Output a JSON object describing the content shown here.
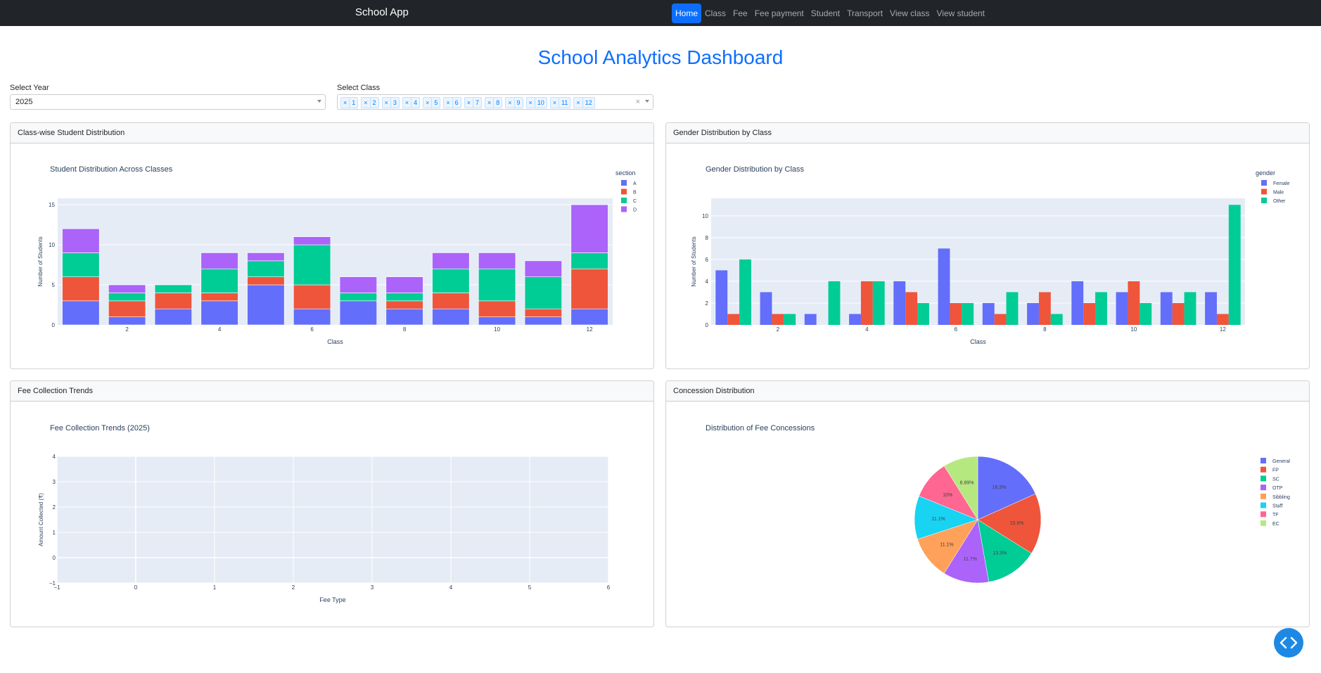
{
  "navbar": {
    "brand": "School App",
    "items": [
      "Home",
      "Class",
      "Fee",
      "Fee payment",
      "Student",
      "Transport",
      "View class",
      "View student"
    ],
    "active": "Home"
  },
  "page_title": "School Analytics Dashboard",
  "filters": {
    "year_label": "Select Year",
    "year_value": "2025",
    "class_label": "Select Class",
    "class_values": [
      "1",
      "2",
      "3",
      "4",
      "5",
      "6",
      "7",
      "8",
      "9",
      "10",
      "11",
      "12"
    ],
    "chip_remove": "×",
    "clear": "×"
  },
  "cards": {
    "class_dist": "Class-wise Student Distribution",
    "gender_dist": "Gender Distribution by Class",
    "fee_trends": "Fee Collection Trends",
    "concession": "Concession Distribution"
  },
  "colors": {
    "blue": "#636efa",
    "red": "#ef553b",
    "green": "#00cc96",
    "purple": "#ab63fa",
    "orange": "#ffa15a",
    "cyan": "#19d3f3",
    "pink": "#ff6692",
    "lime": "#b6e880",
    "plot_bg": "#e5ecf6",
    "title_blue": "#0d6efd",
    "fab": "#1e88e5"
  },
  "chart_data": [
    {
      "type": "bar",
      "barmode": "stack",
      "title": "Student Distribution Across Classes",
      "xlabel": "Class",
      "ylabel": "Number of Students",
      "legend_title": "section",
      "categories": [
        1,
        2,
        3,
        4,
        5,
        6,
        7,
        8,
        9,
        10,
        11,
        12
      ],
      "xticks": [
        2,
        4,
        6,
        8,
        10,
        12
      ],
      "yticks": [
        0,
        5,
        10,
        15
      ],
      "ylim": [
        0,
        15.8
      ],
      "series": [
        {
          "name": "A",
          "color": "#636efa",
          "values": [
            3,
            1,
            2,
            3,
            5,
            2,
            3,
            2,
            2,
            1,
            1,
            2
          ]
        },
        {
          "name": "B",
          "color": "#ef553b",
          "values": [
            3,
            2,
            2,
            1,
            1,
            3,
            0,
            1,
            2,
            2,
            1,
            5
          ]
        },
        {
          "name": "C",
          "color": "#00cc96",
          "values": [
            3,
            1,
            1,
            3,
            2,
            5,
            1,
            1,
            3,
            4,
            4,
            2
          ]
        },
        {
          "name": "D",
          "color": "#ab63fa",
          "values": [
            3,
            1,
            0,
            2,
            1,
            1,
            2,
            2,
            2,
            2,
            2,
            6
          ]
        }
      ]
    },
    {
      "type": "bar",
      "barmode": "group",
      "title": "Gender Distribution by Class",
      "xlabel": "Class",
      "ylabel": "Number of Students",
      "legend_title": "gender",
      "categories": [
        1,
        2,
        3,
        4,
        5,
        6,
        7,
        8,
        9,
        10,
        11,
        12
      ],
      "xticks": [
        2,
        4,
        6,
        8,
        10,
        12
      ],
      "yticks": [
        0,
        2,
        4,
        6,
        8,
        10
      ],
      "ylim": [
        0,
        11.6
      ],
      "series": [
        {
          "name": "Female",
          "color": "#636efa",
          "values": [
            5,
            3,
            1,
            1,
            4,
            7,
            2,
            2,
            4,
            3,
            3,
            3
          ]
        },
        {
          "name": "Male",
          "color": "#ef553b",
          "values": [
            1,
            1,
            0,
            4,
            3,
            2,
            1,
            3,
            2,
            4,
            2,
            1
          ]
        },
        {
          "name": "Other",
          "color": "#00cc96",
          "values": [
            6,
            1,
            4,
            4,
            2,
            2,
            3,
            1,
            3,
            2,
            3,
            11
          ]
        }
      ]
    },
    {
      "type": "line",
      "title": "Fee Collection Trends (2025)",
      "xlabel": "Fee Type",
      "ylabel": "Amount Collected (₹)",
      "xlim": [
        -1,
        6
      ],
      "ylim": [
        -1,
        4
      ],
      "xticks": [
        "−1",
        "0",
        "1",
        "2",
        "3",
        "4",
        "5",
        "6"
      ],
      "yticks": [
        "−1",
        "0",
        "1",
        "2",
        "3",
        "4"
      ],
      "series": []
    },
    {
      "type": "pie",
      "title": "Distribution of Fee Concessions",
      "labels": [
        "General",
        "FP",
        "SC",
        "OTP",
        "Sibbling",
        "Staff",
        "TF",
        "EC"
      ],
      "values": [
        18.3,
        15.6,
        13.3,
        11.7,
        11.1,
        11.1,
        10,
        8.89
      ],
      "value_labels": [
        "18.3%",
        "15.6%",
        "13.3%",
        "11.7%",
        "11.1%",
        "11.1%",
        "10%",
        "8.89%"
      ],
      "colors": [
        "#636efa",
        "#ef553b",
        "#00cc96",
        "#ab63fa",
        "#ffa15a",
        "#19d3f3",
        "#ff6692",
        "#b6e880"
      ]
    }
  ]
}
